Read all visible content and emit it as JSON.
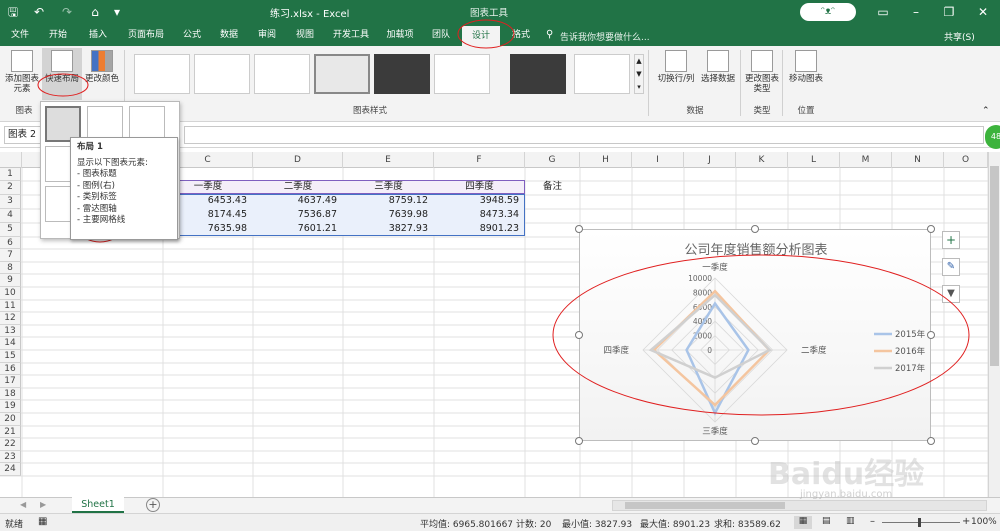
{
  "window": {
    "title": "练习.xlsx  -  Excel",
    "context_tab_group": "图表工具",
    "user_avatar_text": "ᵔᴥᵔ"
  },
  "quick_access": {
    "save_icon": "save-icon",
    "undo_icon": "undo-icon",
    "redo_icon": "redo-icon"
  },
  "tabs": [
    "文件",
    "开始",
    "插入",
    "页面布局",
    "公式",
    "数据",
    "审阅",
    "视图",
    "开发工具",
    "加载项",
    "团队",
    "设计",
    "格式"
  ],
  "active_tab": "设计",
  "tell_me": "告诉我你想要做什么...",
  "share": "共享(S)",
  "ribbon": {
    "add_element": "添加图表元素",
    "add_element_short": "元素",
    "quick_layout": "快速布局",
    "change_colors": "更改颜色",
    "group_chart_layout": "图表",
    "group_chart_styles": "图表样式",
    "switch_row_col": "切换行/列",
    "select_data": "选择数据",
    "group_data": "数据",
    "change_type": "更改图表类型",
    "group_type": "类型",
    "move_chart": "移动图表",
    "group_location": "位置"
  },
  "name_box": "图表 2",
  "columns": [
    "C",
    "D",
    "E",
    "F",
    "G",
    "H",
    "I",
    "J",
    "K",
    "L",
    "M",
    "N",
    "O"
  ],
  "rows": [
    "1",
    "2",
    "3",
    "4",
    "5",
    "6",
    "7",
    "8",
    "9",
    "10",
    "11",
    "12",
    "13",
    "14",
    "15",
    "16",
    "17",
    "18",
    "19",
    "20",
    "21",
    "22",
    "23",
    "24"
  ],
  "table": {
    "headers": [
      "一季度",
      "二季度",
      "三季度",
      "四季度"
    ],
    "remark": "备注",
    "data": [
      [
        "6453.43",
        "4637.49",
        "8759.12",
        "3948.59"
      ],
      [
        "8174.45",
        "7536.87",
        "7639.98",
        "8473.34"
      ],
      [
        "7635.98",
        "7601.21",
        "3827.93",
        "8901.23"
      ]
    ]
  },
  "tooltip": {
    "title": "布局 1",
    "intro": "显示以下图表元素:",
    "items": [
      "- 图表标题",
      "- 图例(右)",
      "- 类别标签",
      "- 雷达图轴",
      "- 主要网格线"
    ]
  },
  "chart_data": {
    "type": "radar",
    "title": "公司年度销售额分析图表",
    "categories": [
      "一季度",
      "二季度",
      "三季度",
      "四季度"
    ],
    "axis_ticks": [
      "10000",
      "8000",
      "6000",
      "4000",
      "2000",
      "0"
    ],
    "ylim": [
      0,
      10000
    ],
    "legend_position": "right",
    "series": [
      {
        "name": "2015年",
        "color": "#a9c4e8",
        "values": [
          6453.43,
          4637.49,
          8759.12,
          3948.59
        ]
      },
      {
        "name": "2016年",
        "color": "#f4c59f",
        "values": [
          8174.45,
          7536.87,
          7639.98,
          8473.34
        ]
      },
      {
        "name": "2017年",
        "color": "#d0d0d0",
        "values": [
          7635.98,
          7601.21,
          3827.93,
          8901.23
        ]
      }
    ]
  },
  "sheet_tab": "Sheet1",
  "status": {
    "ready": "就绪",
    "average": "平均值: 6965.801667",
    "count": "计数: 20",
    "min": "最小值: 3827.93",
    "max": "最大值: 8901.23",
    "sum": "求和: 83589.62",
    "zoom": "100%"
  },
  "badge": "48",
  "watermark": "Baidu经验",
  "watermark_url": "jingyan.baidu.com"
}
